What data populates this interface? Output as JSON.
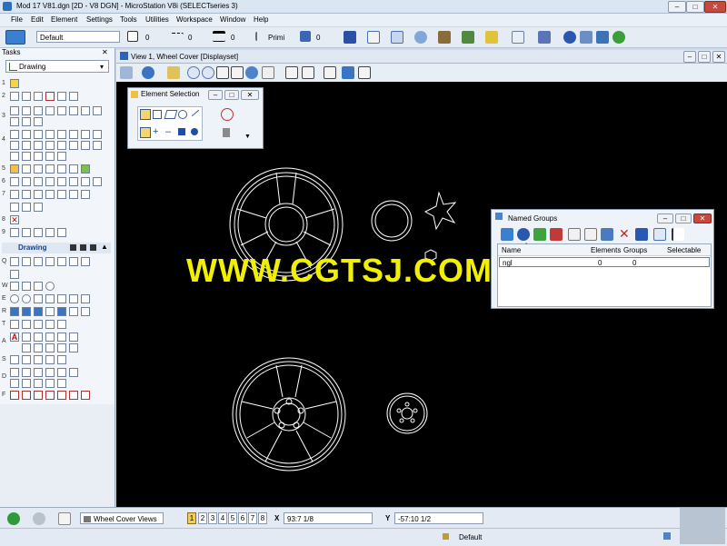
{
  "window": {
    "title": "Mod 17 V81.dgn [2D - V8 DGN] - MicroStation V8i (SELECTseries 3)"
  },
  "menu": [
    "File",
    "Edit",
    "Element",
    "Settings",
    "Tools",
    "Utilities",
    "Workspace",
    "Window",
    "Help"
  ],
  "attributes": {
    "level": "Default",
    "color": "0",
    "style": "0",
    "weight": "0",
    "class": "Primi",
    "transparency": "0"
  },
  "tasks": {
    "header": "Tasks",
    "task_select": "Drawing",
    "section": "Drawing",
    "row_numbers": [
      "1",
      "2",
      "3",
      "4",
      "5",
      "6",
      "7",
      "8",
      "9"
    ],
    "letter_rows": [
      "Q",
      "W",
      "E",
      "R",
      "T",
      "A",
      "S",
      "D",
      "F"
    ],
    "text_glyph": "A"
  },
  "view": {
    "title": "View 1, Wheel Cover [Displayset]"
  },
  "element_selection": {
    "title": "Element Selection"
  },
  "named_groups": {
    "title": "Named Groups",
    "columns": [
      "Name",
      "Elements",
      "Groups",
      "Selectable"
    ],
    "rows": [
      {
        "name": "ngl",
        "elements": "0",
        "groups": "0",
        "selectable": ""
      }
    ]
  },
  "status": {
    "view_group": "Wheel Cover Views",
    "view_buttons": [
      "1",
      "2",
      "3",
      "4",
      "5",
      "6",
      "7",
      "8"
    ],
    "x_label": "X",
    "x_value": "93:7 1/8",
    "y_label": "Y",
    "y_value": "-57:10 1/2",
    "level": "Default"
  },
  "watermark": "WWW.CGTSJ.COM",
  "colors": {
    "accent": "#1a4fb5",
    "canvas": "#000000",
    "watermark": "#f0f000"
  }
}
